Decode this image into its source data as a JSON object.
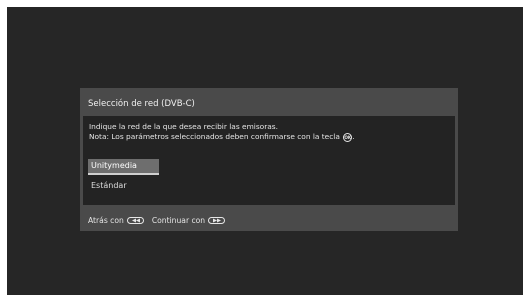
{
  "dialog": {
    "title": "Selección de red (DVB-C)",
    "message_line1": "Indique la red de la que desea recibir las emisoras.",
    "message_line2": "Nota: Los parámetros seleccionados deben confirmarse con la tecla",
    "ok_key_label": "OK",
    "options": [
      {
        "label": "Unitymedia",
        "selected": true
      },
      {
        "label": "Estándar",
        "selected": false
      }
    ],
    "footer": {
      "back_label": "Atrás con",
      "continue_label": "Continuar con",
      "back_key_icon": "rewind-key-icon",
      "continue_key_icon": "fast-forward-key-icon"
    }
  },
  "colors": {
    "screen_bg": "#262626",
    "dialog_bg": "#4a4a4a",
    "body_bg": "#232323",
    "selected_bg": "#6e6e6e"
  }
}
